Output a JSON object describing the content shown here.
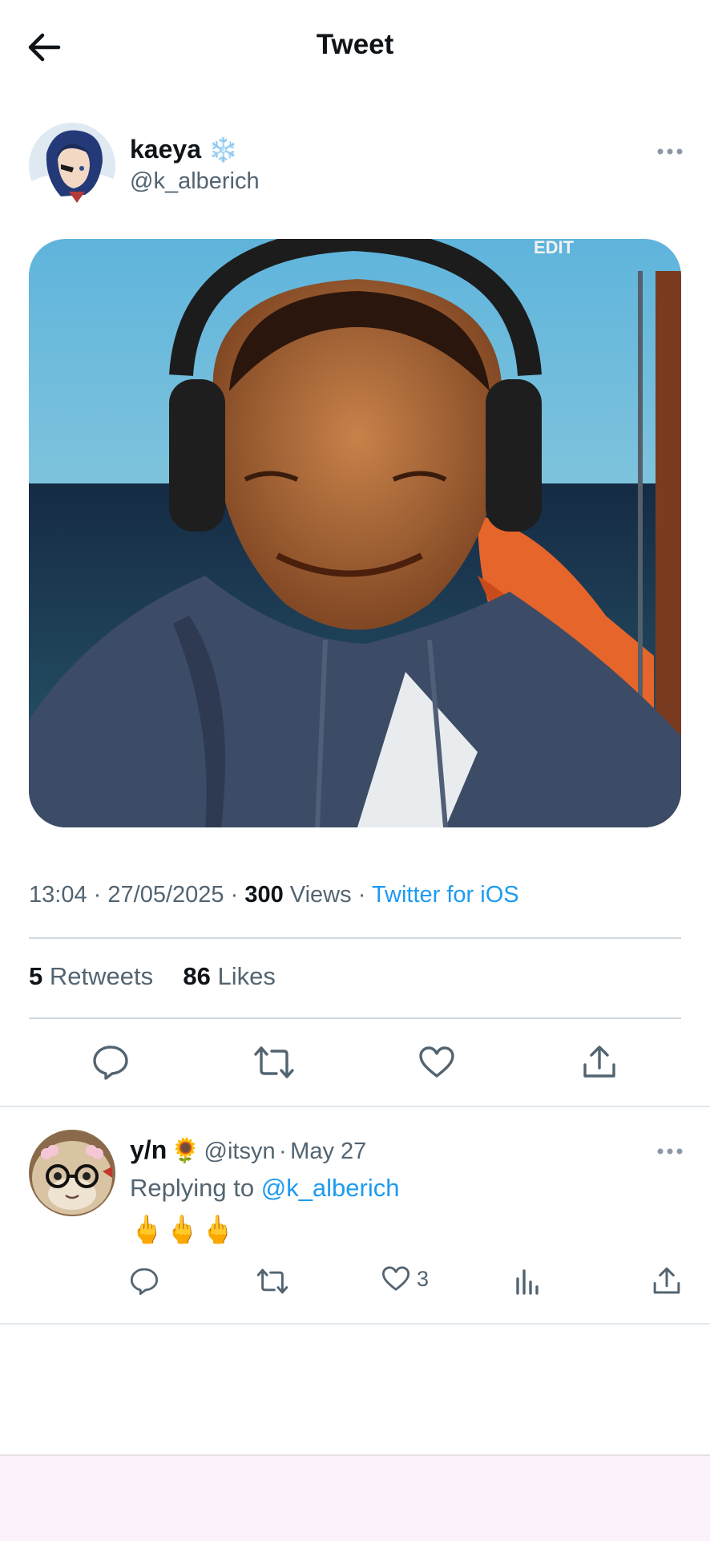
{
  "header": {
    "title": "Tweet"
  },
  "tweet": {
    "author": {
      "name": "kaeya",
      "badge": "❄️",
      "handle": "@k_alberich"
    },
    "time": "13:04",
    "sep1": "·",
    "date": "27/05/2025",
    "sep2": "·",
    "views_count": "300",
    "views_label": "Views",
    "sep3": "·",
    "source": "Twitter for iOS",
    "media_overlay_text": "EDIT",
    "retweets_count": "5",
    "retweets_label": "Retweets",
    "likes_count": "86",
    "likes_label": "Likes"
  },
  "reply": {
    "name": "y/n",
    "badge": "🌻",
    "handle": "@itsyn",
    "sep": "·",
    "date": "May 27",
    "replying_prefix": "Replying to",
    "replying_to": "@k_alberich",
    "body": "🖕🖕🖕",
    "like_count": "3"
  },
  "colors": {
    "accent": "#1d9bf0",
    "text": "#0f1419",
    "muted": "#536471",
    "divider": "#cfd9de"
  }
}
